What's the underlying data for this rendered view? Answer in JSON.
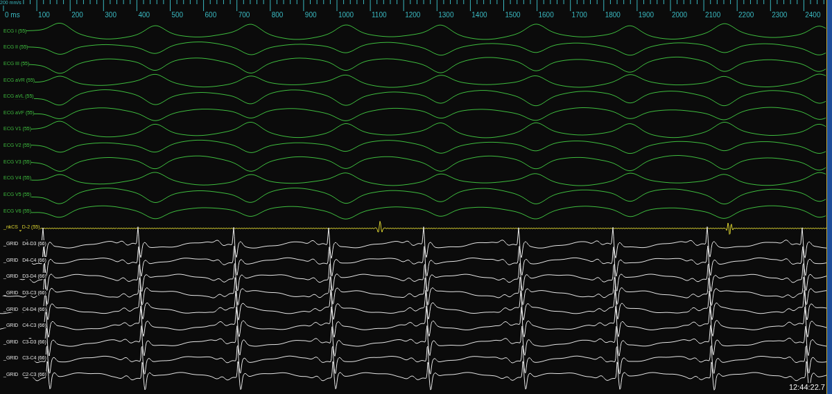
{
  "ruler": {
    "scale": "200 mm/s",
    "ticks": [
      "0 ms",
      "100",
      "200",
      "300",
      "400",
      "500",
      "600",
      "700",
      "800",
      "900",
      "1000",
      "1100",
      "1200",
      "1300",
      "1400",
      "1500",
      "1600",
      "1700",
      "1800",
      "1900",
      "2000",
      "2100",
      "2200",
      "2300",
      "2400"
    ]
  },
  "channels": [
    {
      "label": "ECG I (55)",
      "kind": "ecg"
    },
    {
      "label": "ECG II (55)",
      "kind": "ecg"
    },
    {
      "label": "ECG III (55)",
      "kind": "ecg"
    },
    {
      "label": "ECG aVR (55)",
      "kind": "ecg"
    },
    {
      "label": "ECG aVL (55)",
      "kind": "ecg"
    },
    {
      "label": "ECG aVF (55)",
      "kind": "ecg"
    },
    {
      "label": "ECG V1 (55)",
      "kind": "ecg"
    },
    {
      "label": "ECG V2 (55)",
      "kind": "ecg"
    },
    {
      "label": "ECG V3 (55)",
      "kind": "ecg"
    },
    {
      "label": "ECG V4 (55)",
      "kind": "ecg"
    },
    {
      "label": "ECG V5 (55)",
      "kind": "ecg"
    },
    {
      "label": "ECG V6 (55)",
      "kind": "ecg"
    },
    {
      "label": "_nkCS   D-2 (55)",
      "kind": "cs"
    },
    {
      "label": "_GRID   D4-D3 (66)",
      "kind": "grid"
    },
    {
      "label": "_GRID   D4-C4 (66)",
      "kind": "grid"
    },
    {
      "label": "_GRID   D3-D4 (66)",
      "kind": "grid"
    },
    {
      "label": "_GRID   D3-C3 (66)",
      "kind": "grid"
    },
    {
      "label": "_GRID   C4-D4 (66)",
      "kind": "grid"
    },
    {
      "label": "_GRID   C4-C3 (66)",
      "kind": "grid"
    },
    {
      "label": "_GRID   C3-D3 (66)",
      "kind": "grid"
    },
    {
      "label": "_GRID   C3-C4 (66)",
      "kind": "grid"
    },
    {
      "label": "_GRID   C2-C3 (66)",
      "kind": "grid"
    }
  ],
  "timestamp": "12:44:22.7"
}
